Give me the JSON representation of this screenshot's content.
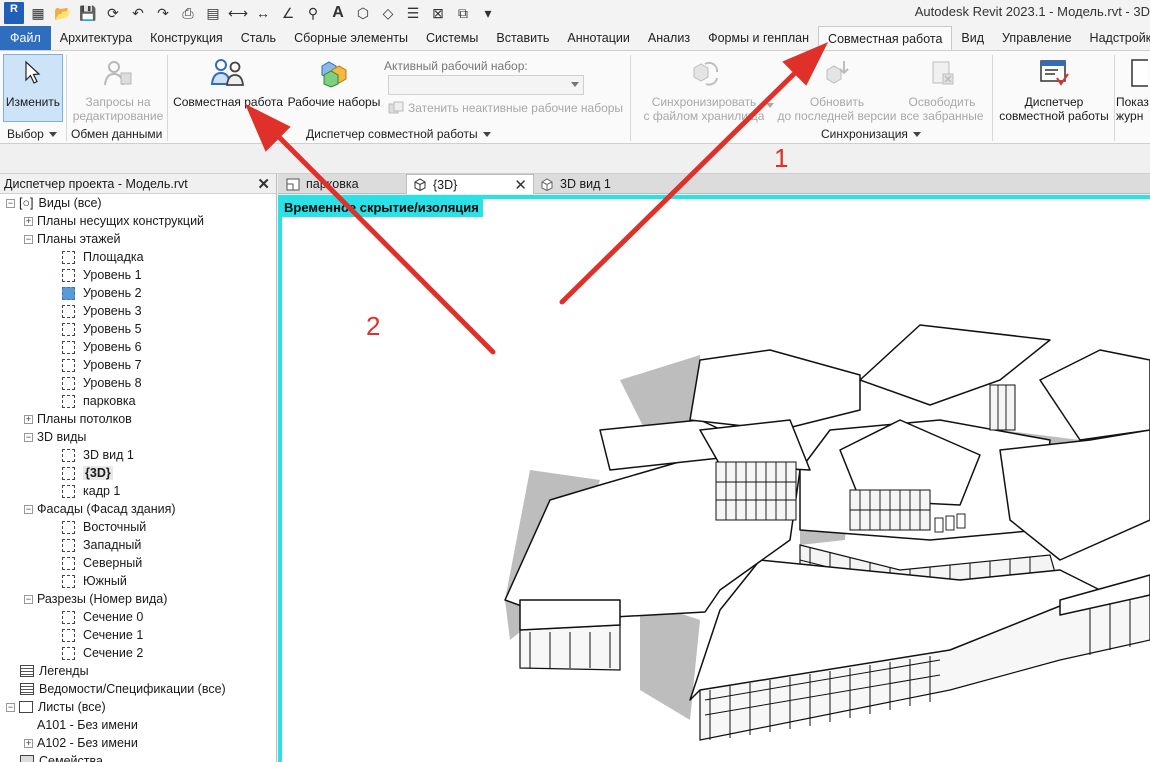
{
  "app": {
    "logo_letter": "R",
    "title": "Autodesk Revit 2023.1 - Модель.rvt - 3D"
  },
  "ribbon_tabs": [
    {
      "label": "Файл"
    },
    {
      "label": "Архитектура"
    },
    {
      "label": "Конструкция"
    },
    {
      "label": "Сталь"
    },
    {
      "label": "Сборные элементы"
    },
    {
      "label": "Системы"
    },
    {
      "label": "Вставить"
    },
    {
      "label": "Аннотации"
    },
    {
      "label": "Анализ"
    },
    {
      "label": "Формы и генплан"
    },
    {
      "label": "Совместная работа"
    },
    {
      "label": "Вид"
    },
    {
      "label": "Управление"
    },
    {
      "label": "Надстройки"
    }
  ],
  "ribbon": {
    "modify_label": "Изменить",
    "select_panel_label": "Выбор",
    "edit_requests_label": "Запросы на редактирование",
    "edit_requests_line1": "Запросы на",
    "edit_requests_line2": "редактирование",
    "exchange_panel_label": "Обмен данными",
    "collaborate_label": "Совместная работа",
    "worksets_label": "Рабочие наборы",
    "active_workset_label": "Активный рабочий набор:",
    "active_workset_value": "",
    "gray_inactive_label": "Затенить неактивные рабочие наборы",
    "manage_collab_panel_label": "Диспетчер совместной работы",
    "sync_line1": "Синхронизировать",
    "sync_line2": "с файлом хранилища",
    "reload_line1": "Обновить",
    "reload_line2": "до последней версии",
    "relinquish_line1": "Освободить",
    "relinquish_line2": "все забранные",
    "sync_panel_label": "Синхронизация",
    "monitor_line1": "Диспетчер",
    "monitor_line2": "совместной работы",
    "show_history_line1": "Показ",
    "show_history_line2": "журн"
  },
  "project_browser": {
    "title": "Диспетчер проекта - Модель.rvt",
    "items": [
      {
        "label": "Виды (все)"
      },
      {
        "label": "Планы несущих конструкций"
      },
      {
        "label": "Планы этажей"
      },
      {
        "label": "Площадка"
      },
      {
        "label": "Уровень 1"
      },
      {
        "label": "Уровень 2"
      },
      {
        "label": "Уровень 3"
      },
      {
        "label": "Уровень 5"
      },
      {
        "label": "Уровень 6"
      },
      {
        "label": "Уровень 7"
      },
      {
        "label": "Уровень 8"
      },
      {
        "label": "парковка"
      },
      {
        "label": "Планы потолков"
      },
      {
        "label": "3D виды"
      },
      {
        "label": "3D вид 1"
      },
      {
        "label": "{3D}"
      },
      {
        "label": "кадр 1"
      },
      {
        "label": "Фасады (Фасад здания)"
      },
      {
        "label": "Восточный"
      },
      {
        "label": "Западный"
      },
      {
        "label": "Северный"
      },
      {
        "label": "Южный"
      },
      {
        "label": "Разрезы (Номер вида)"
      },
      {
        "label": "Сечение 0"
      },
      {
        "label": "Сечение 1"
      },
      {
        "label": "Сечение 2"
      },
      {
        "label": "Легенды"
      },
      {
        "label": "Ведомости/Спецификации (все)"
      },
      {
        "label": "Листы (все)"
      },
      {
        "label": "А101 - Без имени"
      },
      {
        "label": "А102 - Без имени"
      },
      {
        "label": "Семейства"
      }
    ]
  },
  "view_tabs": [
    {
      "label": "парковка"
    },
    {
      "label": "{3D}"
    },
    {
      "label": "3D вид 1"
    }
  ],
  "viewport": {
    "temp_hide_label": "Временное скрытие/изоляция"
  },
  "annotations": {
    "marker_1": "1",
    "marker_2": "2",
    "arrow_color": "#e0302a"
  },
  "colors": {
    "file_tab": "#2f6ebf",
    "viewport_border": "#28e2e8",
    "selected_button": "#cde3f7"
  }
}
